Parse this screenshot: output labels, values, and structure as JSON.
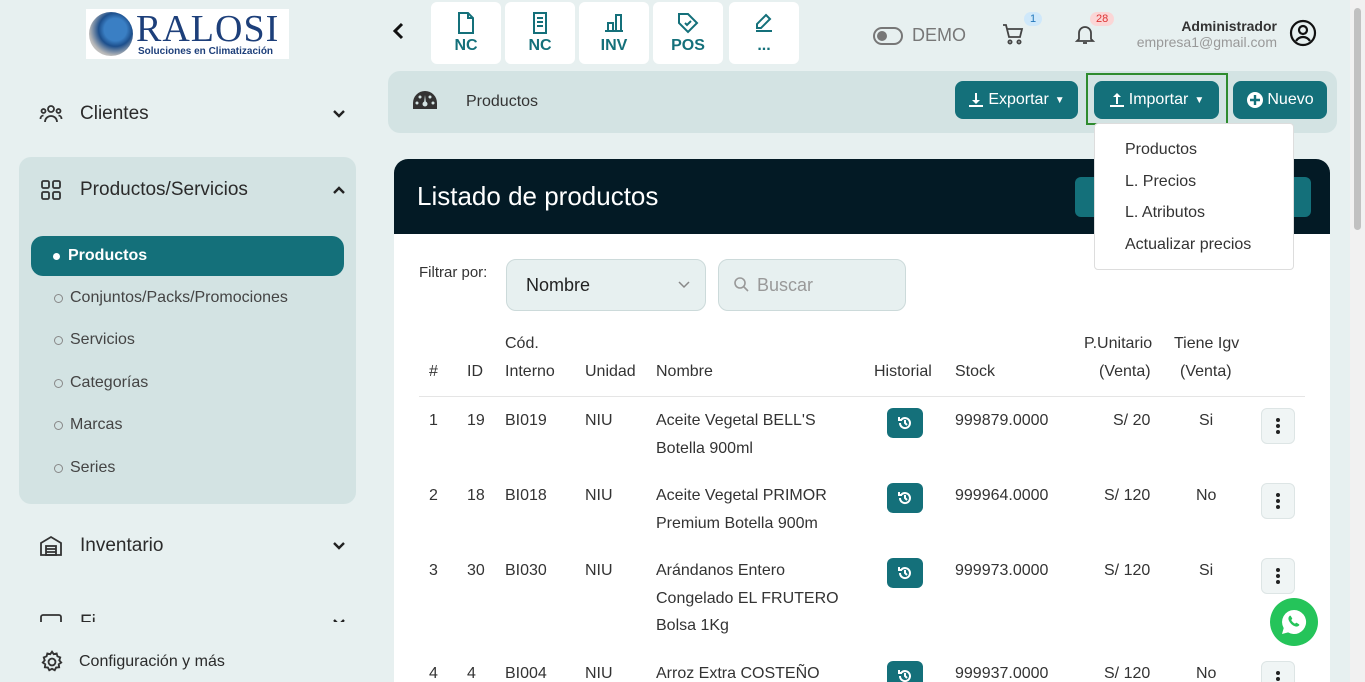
{
  "logo": {
    "brand": "RALOSI",
    "tagline": "Soluciones en Climatización"
  },
  "sidebar": {
    "clientes": "Clientes",
    "productos_servicios": "Productos/Servicios",
    "sub_active": "Productos",
    "sub_items": [
      "Conjuntos/Packs/Promociones",
      "Servicios",
      "Categorías",
      "Marcas",
      "Series"
    ],
    "inventario": "Inventario",
    "clipped_item": "Fi",
    "config": "Configuración y más"
  },
  "topbar": {
    "quick": [
      "NC",
      "NC",
      "INV",
      "POS",
      "..."
    ],
    "demo": "DEMO",
    "cart_badge": "1",
    "bell_badge": "28",
    "user_name": "Administrador",
    "user_email": "empresa1@gmail.com"
  },
  "breadcrumb": {
    "title": "Productos"
  },
  "actions": {
    "exportar": "Exportar",
    "importar": "Importar",
    "nuevo": "Nuevo"
  },
  "dropdown": [
    "Productos",
    "L. Precios",
    "L. Atributos",
    "Actualizar precios"
  ],
  "card": {
    "title": "Listado de productos"
  },
  "filter": {
    "label": "Filtrar por:",
    "select_value": "Nombre",
    "search_placeholder": "Buscar"
  },
  "table": {
    "headers": {
      "num": "#",
      "id": "ID",
      "cod1": "Cód.",
      "cod2": "Interno",
      "unidad": "Unidad",
      "nombre": "Nombre",
      "historial": "Historial",
      "stock": "Stock",
      "pu1": "P.Unitario",
      "pu2": "(Venta)",
      "igv1": "Tiene Igv",
      "igv2": "(Venta)"
    },
    "rows": [
      {
        "num": "1",
        "id": "19",
        "cod": "BI019",
        "unidad": "NIU",
        "nombre1": "Aceite Vegetal BELL'S",
        "nombre2": "Botella 900ml",
        "nombre3": "",
        "stock": "999879.0000",
        "precio": "S/ 20",
        "igv": "Si"
      },
      {
        "num": "2",
        "id": "18",
        "cod": "BI018",
        "unidad": "NIU",
        "nombre1": "Aceite Vegetal PRIMOR",
        "nombre2": "Premium Botella 900m",
        "nombre3": "",
        "stock": "999964.0000",
        "precio": "S/ 120",
        "igv": "No"
      },
      {
        "num": "3",
        "id": "30",
        "cod": "BI030",
        "unidad": "NIU",
        "nombre1": "Arándanos Entero",
        "nombre2": "Congelado EL FRUTERO",
        "nombre3": "Bolsa 1Kg",
        "stock": "999973.0000",
        "precio": "S/ 120",
        "igv": "Si"
      },
      {
        "num": "4",
        "id": "4",
        "cod": "BI004",
        "unidad": "NIU",
        "nombre1": "Arroz Extra COSTEÑO",
        "nombre2": "",
        "nombre3": "",
        "stock": "999937.0000",
        "precio": "S/ 120",
        "igv": "No"
      }
    ]
  },
  "colors": {
    "accent": "#14707a",
    "dark": "#031a25",
    "bg": "#e7f0f0",
    "import_outline": "#2e8b2e"
  }
}
